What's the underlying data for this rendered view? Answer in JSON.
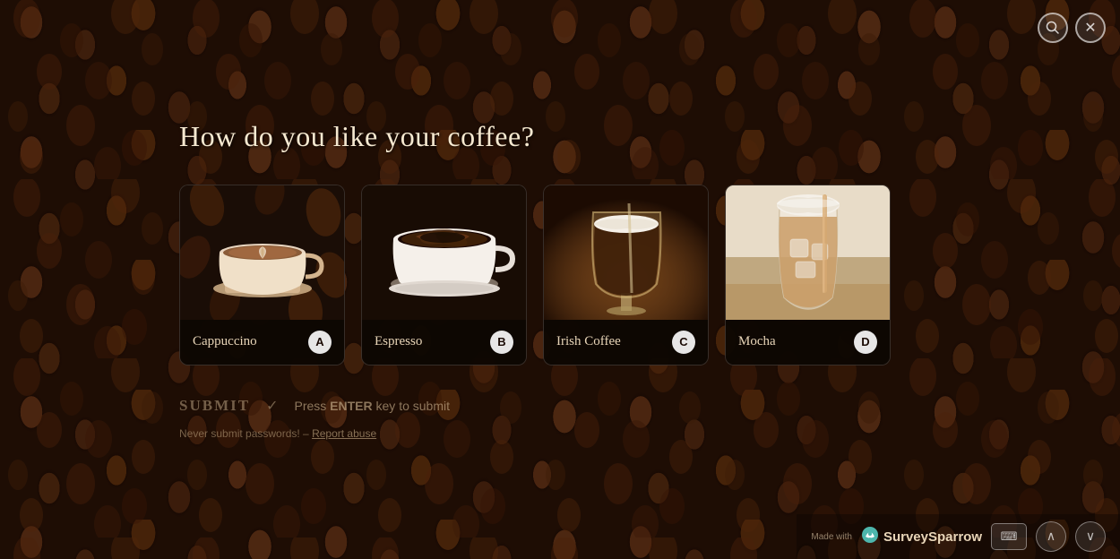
{
  "background": {
    "alt": "coffee beans background"
  },
  "survey": {
    "question": "How do you like your coffee?",
    "options": [
      {
        "id": "A",
        "label": "Cappuccino",
        "key": "A",
        "image_type": "cappuccino"
      },
      {
        "id": "B",
        "label": "Espresso",
        "key": "B",
        "image_type": "espresso"
      },
      {
        "id": "C",
        "label": "Irish Coffee",
        "key": "C",
        "image_type": "irish"
      },
      {
        "id": "D",
        "label": "Mocha",
        "key": "D",
        "image_type": "mocha"
      }
    ]
  },
  "submit": {
    "label": "SUBMIT",
    "checkmark": "✓",
    "enter_hint": "Press ENTER key to submit",
    "enter_key": "ENTER"
  },
  "footer_note": {
    "text": "Never submit passwords! –",
    "report_link": "Report abuse"
  },
  "top_buttons": {
    "search_icon": "🔍",
    "close_icon": "✕"
  },
  "bottom_bar": {
    "made_with": "Made with",
    "brand": "SurveySparrow",
    "keyboard_icon": "⌨",
    "up_icon": "∧",
    "down_icon": "∨"
  }
}
